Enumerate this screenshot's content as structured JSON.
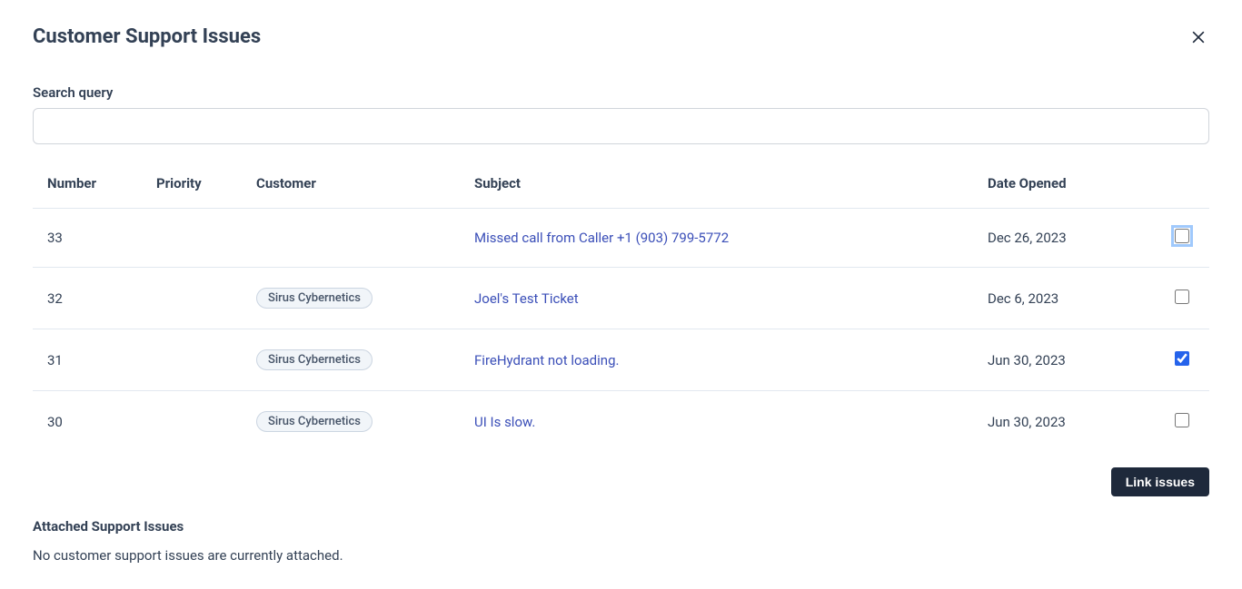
{
  "header": {
    "title": "Customer Support Issues"
  },
  "search": {
    "label": "Search query",
    "value": ""
  },
  "table": {
    "columns": {
      "number": "Number",
      "priority": "Priority",
      "customer": "Customer",
      "subject": "Subject",
      "date_opened": "Date Opened"
    },
    "rows": [
      {
        "number": "33",
        "priority": "",
        "customer": "",
        "subject": "Missed call from Caller +1 (903) 799-5772",
        "date_opened": "Dec 26, 2023",
        "checked": false,
        "focused": true
      },
      {
        "number": "32",
        "priority": "",
        "customer": "Sirus Cybernetics",
        "subject": "Joel's Test Ticket",
        "date_opened": "Dec 6, 2023",
        "checked": false,
        "focused": false
      },
      {
        "number": "31",
        "priority": "",
        "customer": "Sirus Cybernetics",
        "subject": "FireHydrant not loading.",
        "date_opened": "Jun 30, 2023",
        "checked": true,
        "focused": false
      },
      {
        "number": "30",
        "priority": "",
        "customer": "Sirus Cybernetics",
        "subject": "UI Is slow.",
        "date_opened": "Jun 30, 2023",
        "checked": false,
        "focused": false
      }
    ]
  },
  "actions": {
    "link_issues": "Link issues"
  },
  "attached": {
    "title": "Attached Support Issues",
    "empty_text": "No customer support issues are currently attached."
  }
}
